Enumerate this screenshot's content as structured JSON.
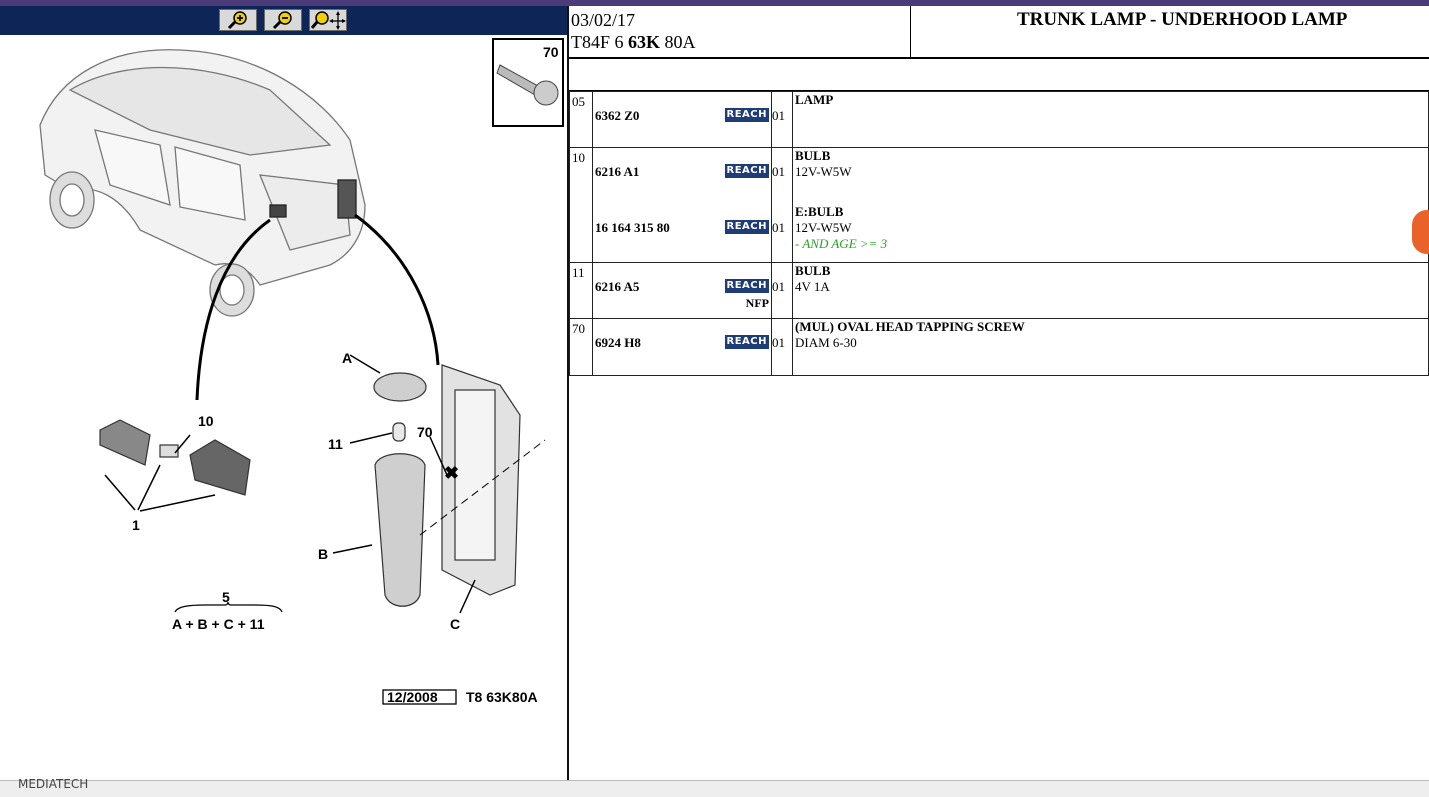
{
  "toolbar": {
    "buttons": [
      {
        "name": "zoom-in"
      },
      {
        "name": "zoom-out"
      },
      {
        "name": "zoom-fit"
      }
    ]
  },
  "diagram": {
    "inset_number": "70",
    "callouts": {
      "A": "A",
      "B": "B",
      "C": "C",
      "n10": "10",
      "n11": "11",
      "n70": "70",
      "n1": "1",
      "n5": "5"
    },
    "formula": "A + B + C + 11",
    "stamp_date": "12/2008",
    "stamp_ref": "T8 63K80A"
  },
  "header": {
    "date": "03/02/17",
    "code_prefix": "T84F 6 ",
    "code_bold": "63K",
    "code_suffix": " 80A",
    "title": "TRUNK LAMP - UNDERHOOD LAMP"
  },
  "parts": [
    {
      "ref": "05",
      "items": [
        {
          "part_no": "6362 Z0",
          "badge": "REACH",
          "qty": "01",
          "name": "LAMP",
          "spec": "",
          "note": "",
          "extra": ""
        }
      ]
    },
    {
      "ref": "10",
      "items": [
        {
          "part_no": "6216 A1",
          "badge": "REACH",
          "qty": "01",
          "name": "BULB",
          "spec": "12V-W5W",
          "note": "",
          "extra": ""
        },
        {
          "part_no": "16 164 315 80",
          "badge": "REACH",
          "qty": "01",
          "name": "E:BULB",
          "spec": "12V-W5W",
          "note": "- AND AGE >= 3",
          "extra": ""
        }
      ]
    },
    {
      "ref": "11",
      "items": [
        {
          "part_no": "6216 A5",
          "badge": "REACH",
          "qty": "01",
          "name": "BULB",
          "spec": "4V 1A",
          "note": "",
          "extra": "NFP"
        }
      ]
    },
    {
      "ref": "70",
      "items": [
        {
          "part_no": "6924 H8",
          "badge": "REACH",
          "qty": "01",
          "name": "(MUL) OVAL HEAD TAPPING SCREW",
          "spec": "DIAM 6-30",
          "note": "",
          "extra": ""
        }
      ]
    }
  ],
  "colors": {
    "toolbar_bg": "#0d2557",
    "reach_badge": "#1e3c78",
    "note_green": "#22a322",
    "accent_bar": "#4b3b78"
  },
  "footer": {
    "text": "MEDIATECH"
  }
}
